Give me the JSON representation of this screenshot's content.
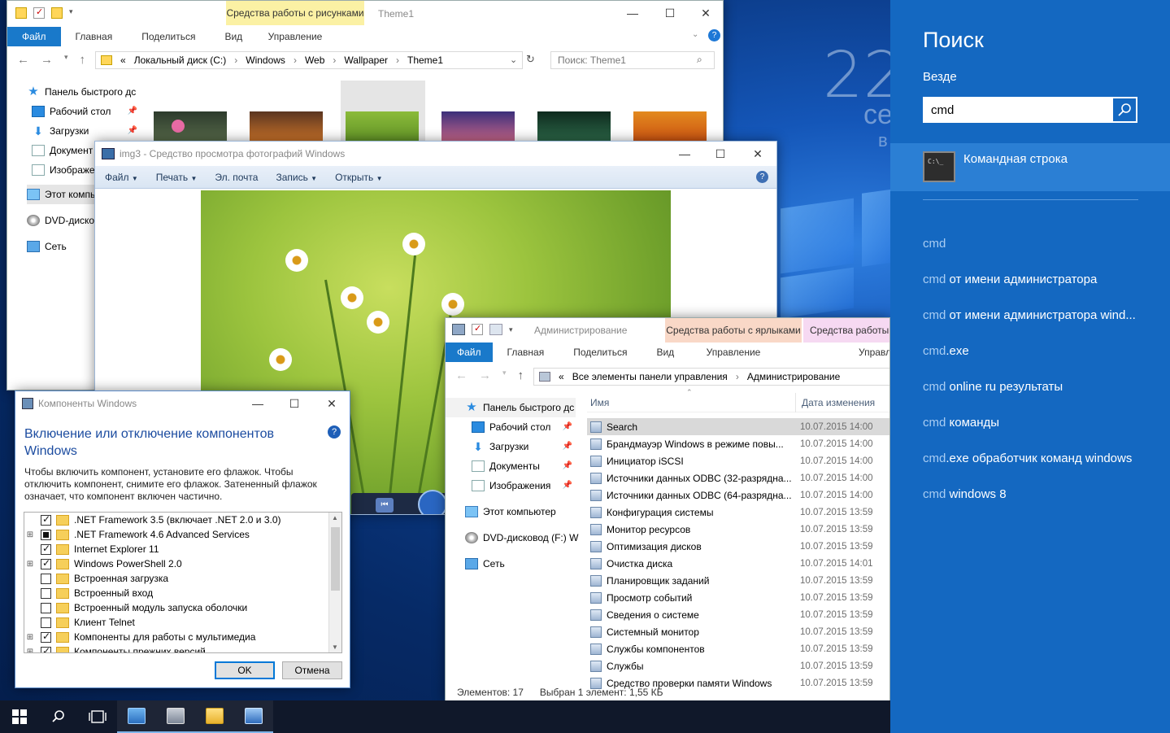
{
  "colors": {
    "accent": "#1468c1",
    "ribbon_file": "#1979ca",
    "picture_tools": "#fbf1a4",
    "shortcut_tools": "#f9d8c7",
    "header_blue": "#1c4ca0"
  },
  "desktop": {
    "clock_time": "22",
    "clock_day": "се",
    "clock_month": "в"
  },
  "explorer1": {
    "ribbon_tabs": [
      "Файл",
      "Главная",
      "Поделиться",
      "Вид"
    ],
    "context_group": "Средства работы с рисунками",
    "context_tab": "Управление",
    "title": "Theme1",
    "address": [
      "Локальный диск (C:)",
      "Windows",
      "Web",
      "Wallpaper",
      "Theme1"
    ],
    "address_prefix": "«",
    "search_placeholder": "Поиск: Theme1",
    "nav": [
      {
        "label": "Панель быстрого дс",
        "icon": "star-icon"
      },
      {
        "label": "Рабочий стол",
        "icon": "desktop-icon"
      },
      {
        "label": "Загрузки",
        "icon": "download-icon"
      },
      {
        "label": "Документ",
        "icon": "documents-icon"
      },
      {
        "label": "Изображе",
        "icon": "pictures-icon"
      },
      {
        "label": "Этот компь",
        "icon": "computer-icon"
      },
      {
        "label": "DVD-дисков",
        "icon": "dvd-icon"
      },
      {
        "label": "Сеть",
        "icon": "network-icon"
      }
    ]
  },
  "photo_viewer": {
    "title": "img3 - Средство просмотра фотографий Windows",
    "menu": [
      "Файл",
      "Печать",
      "Эл. почта",
      "Запись",
      "Открыть"
    ]
  },
  "features": {
    "title": "Компоненты Windows",
    "heading": "Включение или отключение компонентов Windows",
    "description": "Чтобы включить компонент, установите его флажок. Чтобы отключить компонент, снимите его флажок. Затененный флажок означает, что компонент включен частично.",
    "items": [
      {
        "label": ".NET Framework 3.5 (включает .NET 2.0 и 3.0)",
        "state": "checked",
        "expand": false
      },
      {
        "label": ".NET Framework 4.6 Advanced Services",
        "state": "partial",
        "expand": true
      },
      {
        "label": "Internet Explorer 11",
        "state": "checked",
        "expand": false
      },
      {
        "label": "Windows PowerShell 2.0",
        "state": "checked",
        "expand": true
      },
      {
        "label": "Встроенная загрузка",
        "state": "unchecked",
        "expand": false
      },
      {
        "label": "Встроенный вход",
        "state": "unchecked",
        "expand": false
      },
      {
        "label": "Встроенный модуль запуска оболочки",
        "state": "unchecked",
        "expand": false
      },
      {
        "label": "Клиент Telnet",
        "state": "unchecked",
        "expand": false
      },
      {
        "label": "Компоненты для работы с мультимедиа",
        "state": "checked",
        "expand": true
      },
      {
        "label": "Компоненты прежних версий",
        "state": "checked",
        "expand": true
      }
    ],
    "ok": "OK",
    "cancel": "Отмена"
  },
  "explorer2": {
    "title": "Администрирование",
    "context_group_1": "Средства работы с ярлыками",
    "context_tab_1": "Управление",
    "context_group_2": "Средства работы с",
    "context_tab_2": "Управл",
    "ribbon_tabs": [
      "Файл",
      "Главная",
      "Поделиться",
      "Вид"
    ],
    "address": [
      "Все элементы панели управления",
      "Администрирование"
    ],
    "address_prefix": "«",
    "nav": [
      {
        "label": "Панель быстрого дс",
        "icon": "star-icon",
        "pin": false
      },
      {
        "label": "Рабочий стол",
        "icon": "desktop-icon",
        "pin": true
      },
      {
        "label": "Загрузки",
        "icon": "download-icon",
        "pin": true
      },
      {
        "label": "Документы",
        "icon": "documents-icon",
        "pin": true
      },
      {
        "label": "Изображения",
        "icon": "pictures-icon",
        "pin": true
      },
      {
        "label": "Этот компьютер",
        "icon": "computer-icon",
        "pin": false
      },
      {
        "label": "DVD-дисковод (F:) W",
        "icon": "dvd-icon",
        "pin": false
      },
      {
        "label": "Сеть",
        "icon": "network-icon",
        "pin": false
      }
    ],
    "columns": [
      "Имя",
      "Дата изменения"
    ],
    "files": [
      {
        "name": "Search",
        "date": "10.07.2015 14:00",
        "selected": true
      },
      {
        "name": "Брандмауэр Windows в режиме повы...",
        "date": "10.07.2015 14:00"
      },
      {
        "name": "Инициатор iSCSI",
        "date": "10.07.2015 14:00"
      },
      {
        "name": "Источники данных ODBC (32-разрядна...",
        "date": "10.07.2015 14:00"
      },
      {
        "name": "Источники данных ODBC (64-разрядна...",
        "date": "10.07.2015 14:00"
      },
      {
        "name": "Конфигурация системы",
        "date": "10.07.2015 13:59"
      },
      {
        "name": "Монитор ресурсов",
        "date": "10.07.2015 13:59"
      },
      {
        "name": "Оптимизация дисков",
        "date": "10.07.2015 13:59"
      },
      {
        "name": "Очистка диска",
        "date": "10.07.2015 14:01"
      },
      {
        "name": "Планировщик заданий",
        "date": "10.07.2015 13:59"
      },
      {
        "name": "Просмотр событий",
        "date": "10.07.2015 13:59"
      },
      {
        "name": "Сведения о системе",
        "date": "10.07.2015 13:59"
      },
      {
        "name": "Системный монитор",
        "date": "10.07.2015 13:59"
      },
      {
        "name": "Службы компонентов",
        "date": "10.07.2015 13:59"
      },
      {
        "name": "Службы",
        "date": "10.07.2015 13:59"
      },
      {
        "name": "Средство проверки памяти Windows",
        "date": "10.07.2015 13:59"
      }
    ],
    "status_count": "Элементов: 17",
    "status_selected": "Выбран 1 элемент: 1,55 КБ"
  },
  "search_panel": {
    "heading": "Поиск",
    "scope": "Везде",
    "query": "cmd",
    "best_match": "Командная строка",
    "suggestions": [
      {
        "q": "cmd",
        "rest": ""
      },
      {
        "q": "cmd",
        "rest": " от имени администратора"
      },
      {
        "q": "cmd",
        "rest": " от имени администратора wind..."
      },
      {
        "q": "cmd",
        "rest": ".exe"
      },
      {
        "q": "cmd",
        "rest": " online ru результаты"
      },
      {
        "q": "cmd",
        "rest": " команды"
      },
      {
        "q": "cmd",
        "rest": ".exe обработчик команд windows"
      },
      {
        "q": "cmd",
        "rest": " windows 8"
      }
    ]
  },
  "taskbar": {
    "items": [
      {
        "name": "start-button",
        "icon": "windows-logo-icon"
      },
      {
        "name": "search-button",
        "icon": "search-icon"
      },
      {
        "name": "task-view-button",
        "icon": "task-view-icon"
      },
      {
        "name": "taskbar-app-control-panel",
        "icon": "control-panel-icon"
      },
      {
        "name": "taskbar-app-features",
        "icon": "installer-icon"
      },
      {
        "name": "taskbar-app-explorer",
        "icon": "folder-icon"
      },
      {
        "name": "taskbar-app-photo-viewer",
        "icon": "photo-viewer-icon"
      }
    ]
  }
}
